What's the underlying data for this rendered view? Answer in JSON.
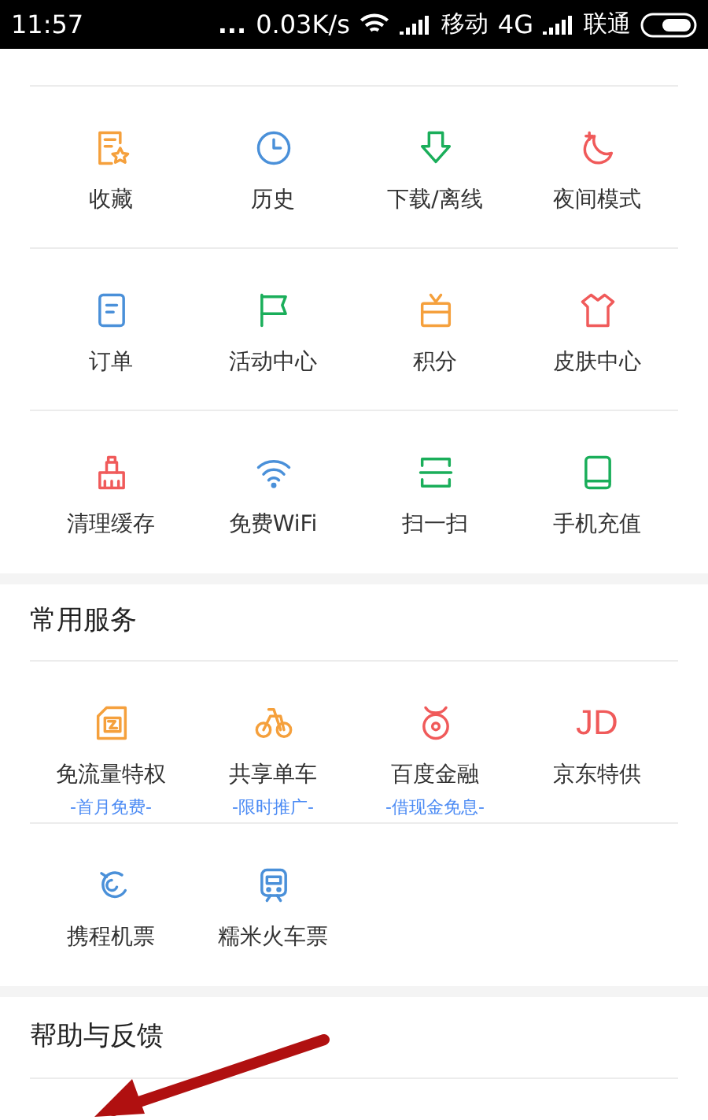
{
  "status_bar": {
    "time": "11:57",
    "dots": "...",
    "speed": "0.03K/s",
    "carrier_1": "移动",
    "network": "4G",
    "carrier_2": "联通"
  },
  "functions": {
    "rows": [
      [
        {
          "label": "收藏",
          "color": "#f5a03c"
        },
        {
          "label": "历史",
          "color": "#4a90d9"
        },
        {
          "label": "下载/离线",
          "color": "#1aae5a"
        },
        {
          "label": "夜间模式",
          "color": "#f05a5a"
        }
      ],
      [
        {
          "label": "订单",
          "color": "#4a90d9"
        },
        {
          "label": "活动中心",
          "color": "#1aae5a"
        },
        {
          "label": "积分",
          "color": "#f5a03c"
        },
        {
          "label": "皮肤中心",
          "color": "#f05a5a"
        }
      ],
      [
        {
          "label": "清理缓存",
          "color": "#f05a5a"
        },
        {
          "label": "免费WiFi",
          "color": "#4a90d9"
        },
        {
          "label": "扫一扫",
          "color": "#1aae5a"
        },
        {
          "label": "手机充值",
          "color": "#1aae5a"
        }
      ]
    ]
  },
  "services": {
    "title": "常用服务",
    "rows": [
      [
        {
          "label": "免流量特权",
          "sub": "-首月免费-",
          "color": "#f5a03c"
        },
        {
          "label": "共享单车",
          "sub": "-限时推广-",
          "color": "#f5a03c"
        },
        {
          "label": "百度金融",
          "sub": "-借现金免息-",
          "color": "#f05a5a"
        },
        {
          "label": "京东特供",
          "logo_text": "JD",
          "color": "#f05a5a"
        }
      ],
      [
        {
          "label": "携程机票",
          "color": "#4a90d9"
        },
        {
          "label": "糯米火车票",
          "color": "#4a90d9"
        }
      ]
    ]
  },
  "help": {
    "title": "帮助与反馈"
  }
}
